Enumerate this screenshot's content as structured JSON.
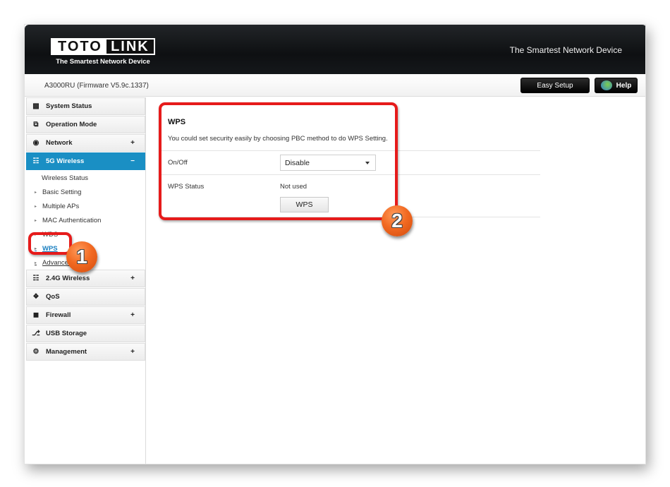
{
  "header": {
    "logo_left": "TOTO",
    "logo_right": "LINK",
    "logo_tagline": "The Smartest Network Device",
    "slogan": "The Smartest Network Device"
  },
  "subbar": {
    "model": "A3000RU (Firmware V5.9c.1337)",
    "easy_setup_label": "Easy Setup",
    "help_label": "Help"
  },
  "sidebar": {
    "items": [
      {
        "label": "System Status",
        "icon": "chat-icon",
        "sign": ""
      },
      {
        "label": "Operation Mode",
        "icon": "windows-icon",
        "sign": ""
      },
      {
        "label": "Network",
        "icon": "globe-icon",
        "sign": "+"
      },
      {
        "label": "5G Wireless",
        "icon": "wifi-icon",
        "sign": "−"
      },
      {
        "label": "2.4G Wireless",
        "icon": "wifi-icon",
        "sign": "+"
      },
      {
        "label": "QoS",
        "icon": "qos-icon",
        "sign": ""
      },
      {
        "label": "Firewall",
        "icon": "lock-icon",
        "sign": "+"
      },
      {
        "label": "USB Storage",
        "icon": "usb-icon",
        "sign": ""
      },
      {
        "label": "Management",
        "icon": "gear-icon",
        "sign": "+"
      }
    ],
    "submenu_5g": [
      "Wireless Status",
      "Basic Setting",
      "Multiple APs",
      "MAC Authentication",
      "WDS",
      "WPS",
      "Advanced"
    ],
    "current_sub": "WPS"
  },
  "main": {
    "title": "WPS",
    "description": "You could set security easily by choosing PBC method to do WPS Setting.",
    "onoff_label": "On/Off",
    "onoff_value": "Disable",
    "status_label": "WPS Status",
    "status_value": "Not used",
    "wps_button": "WPS"
  },
  "annotations": {
    "badge1": "1",
    "badge2": "2",
    "highlight_color": "#e61b1b",
    "badge_color": "#f26a22"
  },
  "colors": {
    "accent": "#1a8fc4",
    "header_bg": "#0e1012"
  }
}
